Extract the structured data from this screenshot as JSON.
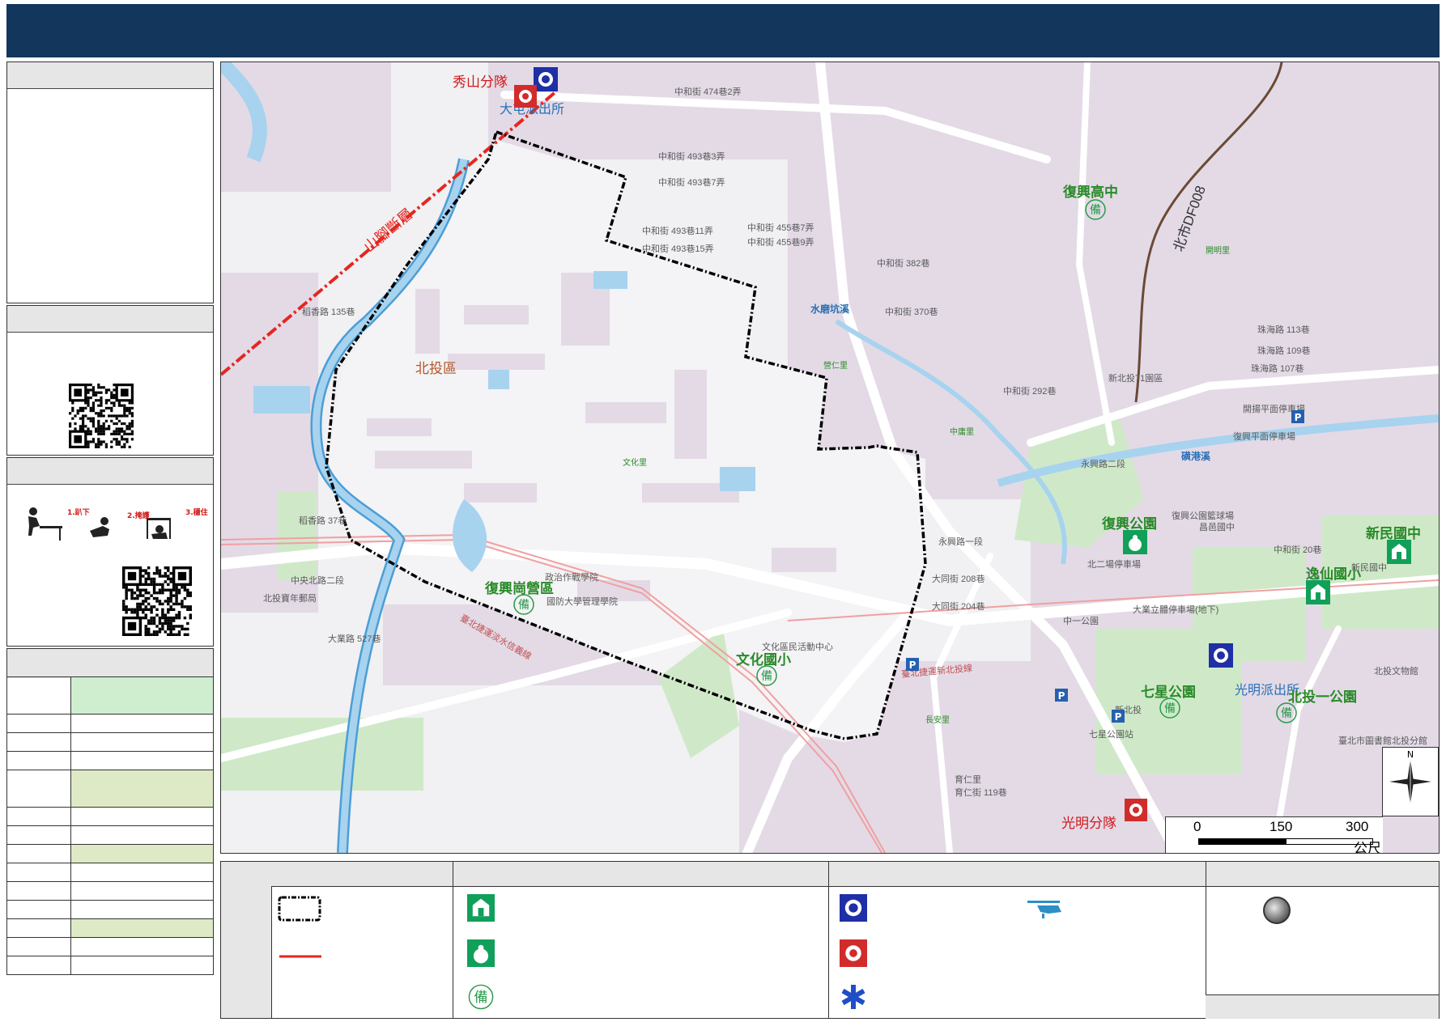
{
  "map": {
    "labels": {
      "xiushan_team": "秀山分隊",
      "datun_station": "大屯派出所",
      "beitou_district": "北投區",
      "fuxing_high": "復興高中",
      "fuxing_park": "復興公園",
      "fugang_camp": "復興崗營區",
      "wenhua_elem": "文化國小",
      "xinmin_high": "新民國中",
      "yixian_elem": "逸仙國小",
      "qixing_park": "七星公園",
      "guangming_station": "光明派出所",
      "beitou_park1": "北投一公園",
      "guangming_team": "光明分隊",
      "shanjiao_fault": "山腳斷層",
      "fault_id": "北市DF008",
      "shuimokeng_creek": "水磨坑溪",
      "linggang_creek": "磺港溪",
      "wenhua_li": "文化里",
      "zhongyong_li": "中庸里",
      "yingren_li": "營仁里",
      "changan_li": "長安里",
      "kaiming_li": "開明里",
      "bei_tou_71": "新北投71園區",
      "fuxing_parking": "復興平面停車場",
      "kaiming_parking": "開揚平面停車場",
      "zhonghe_455_7": "中和街 455巷7弄",
      "zhonghe_455_9": "中和街 455巷9弄",
      "zhonghe_493_11": "中和街 493巷11弄",
      "zhonghe_493_15": "中和街 493巷15弄",
      "zhonghe_493_7": "中和街 493巷7弄",
      "zhonghe_493_3": "中和街 493巷3弄",
      "zhonghe_382": "中和街 382巷",
      "zhonghe_370": "中和街 370巷",
      "zhonghe_292": "中和街 292巷",
      "zhonghe_474": "中和街 474巷2弄",
      "daohu_135": "稻香路 135巷",
      "daohu_37": "稻香路 37巷",
      "zhongyang_n2": "中央北路二段",
      "daye_527": "大業路 527巷",
      "yongxing_2": "永興路二段",
      "yongxing_1": "永興路一段",
      "datong_208": "大同街 208巷",
      "datong_204": "大同街 204巷",
      "zhuhai_113": "珠海路 113巷",
      "zhuhai_109": "珠海路 109巷",
      "zhuhai_107": "珠海路 107巷",
      "zhonghe_20": "中和街 20巷",
      "mrt_line": "臺北捷運淡水信義線",
      "mrt_xinbeitou": "臺北捷運新北投線",
      "beitou_youth": "北投寶年郵局",
      "fuxing_elem_high": "昌邑國中",
      "civic_center": "文化區民活動中心",
      "nat_def_univ": "國防大學管理學院",
      "political_warfare": "政治作戰學院",
      "fuxing_court": "復興公園籃球場",
      "beitou_lib": "臺北市圖書館北投分館",
      "beitou_museum": "北投文物館",
      "qixing_station": "七星公園站",
      "xinbeitou_station": "新北投",
      "yucheng": "育仁里",
      "zhongshan_119": "育仁街 119巷",
      "xinmin_school": "新民國中",
      "parking_beier": "北二場停車場",
      "park_zhongyi": "中一公園",
      "park_danan": "大業立體停車場(地下)"
    },
    "scale": {
      "ticks": [
        "0",
        "150",
        "300"
      ],
      "unit": "公尺"
    },
    "compass": "N"
  },
  "colors": {
    "header": "#12365c",
    "map_bg": "#f1f0f3",
    "block": "#e1d8e4",
    "road": "#ffffff",
    "river": "#a7d3ef",
    "river_edge": "#4b9ed6",
    "park": "#cfe9c8",
    "fault": "#e5261f",
    "fault_line": "#6b4a34",
    "table_green_1": "#cfeed0",
    "table_green_2": "#deeac6"
  }
}
